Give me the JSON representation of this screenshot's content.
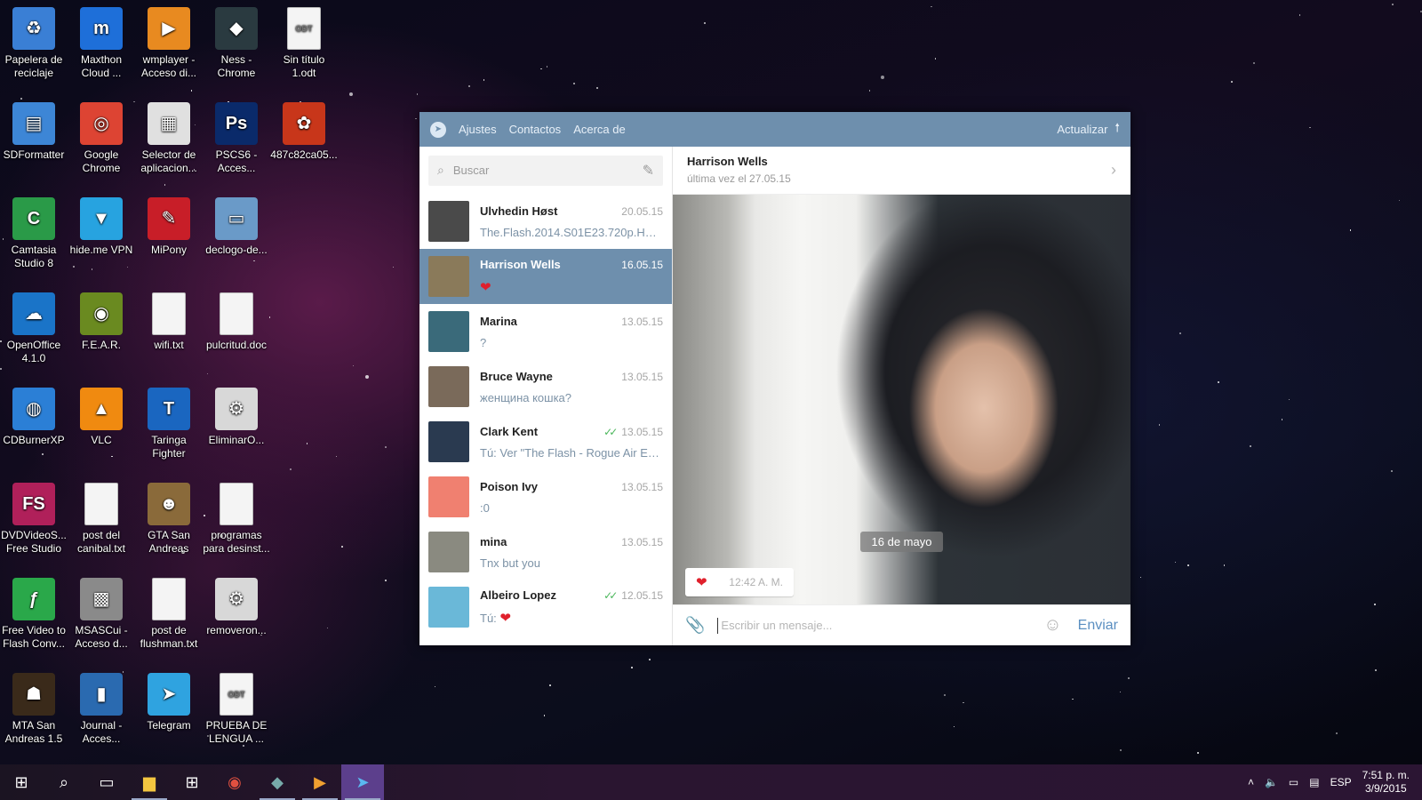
{
  "desktop": {
    "icons": [
      {
        "label": "Papelera de reciclaje",
        "glyph": "♻",
        "color": "#3a7fd5"
      },
      {
        "label": "Maxthon Cloud ...",
        "glyph": "m",
        "color": "#1e6fd9"
      },
      {
        "label": "wmplayer - Acceso di...",
        "glyph": "▶",
        "color": "#e88a20"
      },
      {
        "label": "Ness - Chrome",
        "glyph": "◆",
        "color": "#2a3a40"
      },
      {
        "label": "Sin título 1.odt",
        "glyph": "ODT",
        "color": "#f4f4f4"
      },
      {
        "label": "SDFormatter",
        "glyph": "▤",
        "color": "#3d86d6"
      },
      {
        "label": "Google Chrome",
        "glyph": "◎",
        "color": "#dd4433"
      },
      {
        "label": "Selector de aplicacion...",
        "glyph": "▦",
        "color": "#e0e0e0"
      },
      {
        "label": "PSCS6 - Acces...",
        "glyph": "Ps",
        "color": "#0a2a6a"
      },
      {
        "label": "487c82ca05...",
        "glyph": "✿",
        "color": "#c8361a"
      },
      {
        "label": "Camtasia Studio 8",
        "glyph": "C",
        "color": "#2a9a48"
      },
      {
        "label": "hide.me VPN",
        "glyph": "▼",
        "color": "#27a3e0"
      },
      {
        "label": "MiPony",
        "glyph": "✎",
        "color": "#c81e28"
      },
      {
        "label": "declogo-de...",
        "glyph": "▭",
        "color": "#6a9ac8"
      },
      {
        "label": "OpenOffice 4.1.0",
        "glyph": "☁",
        "color": "#1a74c8"
      },
      {
        "label": "F.E.A.R.",
        "glyph": "◉",
        "color": "#6a8a20"
      },
      {
        "label": "wifi.txt",
        "glyph": "",
        "color": "#f4f4f4"
      },
      {
        "label": "pulcritud.doc",
        "glyph": "",
        "color": "#f4f4f4"
      },
      {
        "label": "CDBurnerXP",
        "glyph": "◍",
        "color": "#2b7fd6"
      },
      {
        "label": "VLC",
        "glyph": "▲",
        "color": "#f08a10"
      },
      {
        "label": "Taringa Fighter",
        "glyph": "T",
        "color": "#1a66c0"
      },
      {
        "label": "EliminarO...",
        "glyph": "⚙",
        "color": "#d8d8d8"
      },
      {
        "label": "DVDVideoS... Free Studio",
        "glyph": "FS",
        "color": "#b0205a"
      },
      {
        "label": "post del canibal.txt",
        "glyph": "",
        "color": "#f4f4f4"
      },
      {
        "label": "GTA San Andreas",
        "glyph": "☻",
        "color": "#8a6a3a"
      },
      {
        "label": "programas para desinst...",
        "glyph": "",
        "color": "#f4f4f4"
      },
      {
        "label": "Free Video to Flash Conv...",
        "glyph": "ƒ",
        "color": "#2aa84a"
      },
      {
        "label": "MSASCui - Acceso d...",
        "glyph": "▩",
        "color": "#8a8a8a"
      },
      {
        "label": "post de flushman.txt",
        "glyph": "",
        "color": "#f4f4f4"
      },
      {
        "label": "removeron...",
        "glyph": "⚙",
        "color": "#d8d8d8"
      },
      {
        "label": "MTA San Andreas 1.5",
        "glyph": "☗",
        "color": "#3a2a1a"
      },
      {
        "label": "Journal - Acces...",
        "glyph": "▮",
        "color": "#2a6ab0"
      },
      {
        "label": "Telegram",
        "glyph": "➤",
        "color": "#2fa3e0"
      },
      {
        "label": "PRUEBA DE LENGUA ...",
        "glyph": "ODT",
        "color": "#f4f4f4"
      }
    ]
  },
  "telegram": {
    "menu": {
      "settings": "Ajustes",
      "contacts": "Contactos",
      "about": "Acerca de",
      "update": "Actualizar"
    },
    "search": {
      "placeholder": "Buscar"
    },
    "chats": [
      {
        "name": "Ulvhedin Høst",
        "date": "20.05.15",
        "preview": "The.Flash.2014.S01E23.720p.HDT...",
        "read": false,
        "avatar_color": "#4a4a4a",
        "active": false,
        "preview_heart": false
      },
      {
        "name": "Harrison Wells",
        "date": "16.05.15",
        "preview": "",
        "read": false,
        "avatar_color": "#8a7a5a",
        "active": true,
        "preview_heart": true
      },
      {
        "name": "Marina",
        "date": "13.05.15",
        "preview": "?",
        "read": false,
        "avatar_color": "#3a6a7a",
        "active": false,
        "preview_heart": false
      },
      {
        "name": "Bruce Wayne",
        "date": "13.05.15",
        "preview": "женщина кошка?",
        "read": false,
        "avatar_color": "#7a6a5a",
        "active": false,
        "preview_heart": false
      },
      {
        "name": "Clark Kent",
        "date": "13.05.15",
        "preview": "Tú: Ver \"The Flash - Rogue Air Ext...",
        "read": true,
        "avatar_color": "#2a3a50",
        "active": false,
        "preview_heart": false
      },
      {
        "name": "Poison Ivy",
        "date": "13.05.15",
        "preview": ":0",
        "read": false,
        "avatar_color": "#f08070",
        "active": false,
        "preview_heart": false
      },
      {
        "name": "mina",
        "date": "13.05.15",
        "preview": "Tnx but you",
        "read": false,
        "avatar_color": "#8a8a80",
        "active": false,
        "preview_heart": false
      },
      {
        "name": "Albeiro Lopez",
        "date": "12.05.15",
        "preview": "Tú: ",
        "read": true,
        "avatar_color": "#6ab8d8",
        "active": false,
        "preview_heart": true
      }
    ],
    "conversation": {
      "peer_name": "Harrison Wells",
      "peer_status": "última vez el 27.05.15",
      "date_separator": "16 de mayo",
      "message_time": "12:42 A. M.",
      "input_placeholder": "Escribir un mensaje...",
      "send_label": "Enviar"
    }
  },
  "taskbar": {
    "items": [
      "start-icon",
      "search-icon",
      "task-view-icon",
      "file-explorer-icon",
      "store-icon",
      "chrome-icon",
      "ness-icon",
      "media-player-icon",
      "telegram-icon"
    ],
    "language": "ESP",
    "time": "7:51 p. m.",
    "date": "3/9/2015"
  },
  "colors": {
    "telegram_header": "#6e8fad",
    "active_chat": "#6e8fad",
    "send_button": "#5b8fc1",
    "heart": "#e0202c",
    "read_check": "#4cb75c"
  }
}
